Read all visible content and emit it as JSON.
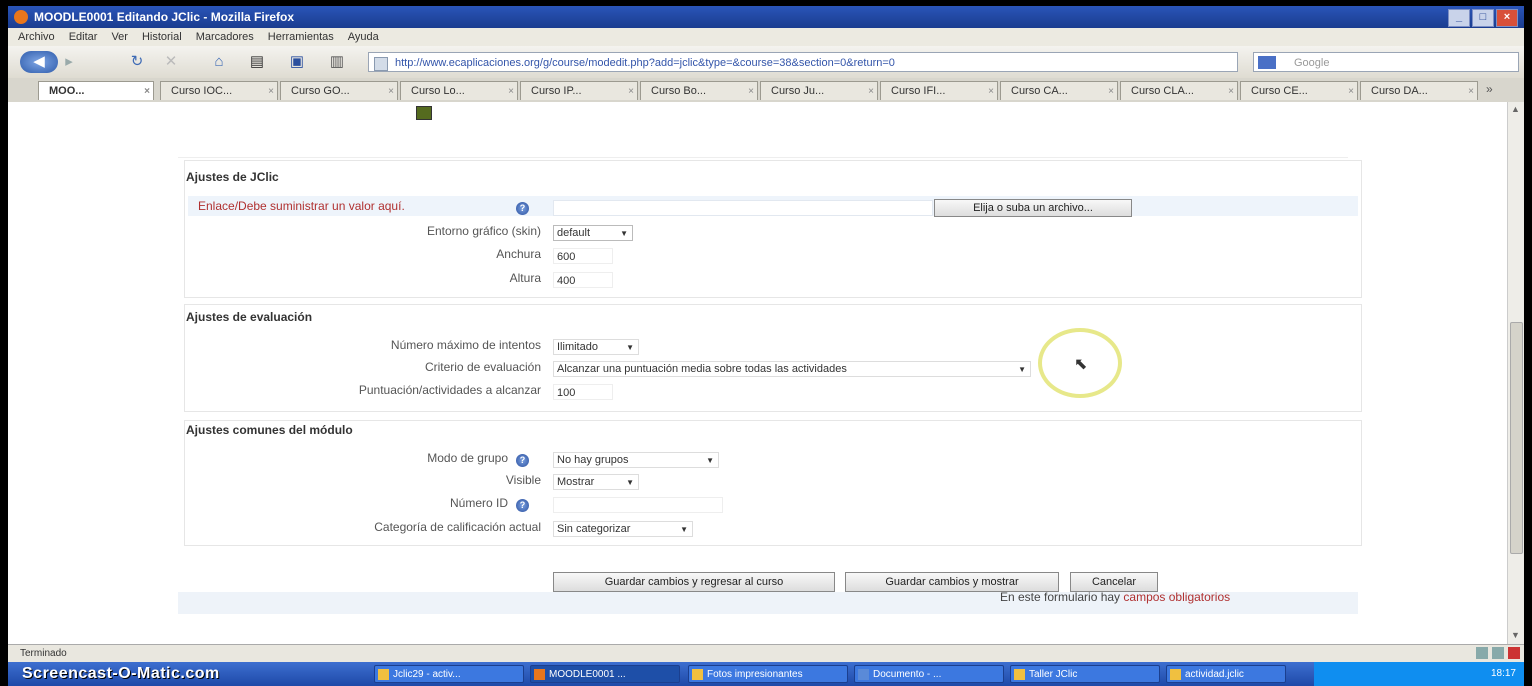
{
  "window": {
    "title": "MOODLE0001 Editando JClic - Mozilla Firefox"
  },
  "menu": [
    "Archivo",
    "Editar",
    "Ver",
    "Historial",
    "Marcadores",
    "Herramientas",
    "Ayuda"
  ],
  "nav": {
    "url": "http://www.ecaplicaciones.org/g/course/modedit.php?add=jclic&type=&course=38&section=0&return=0",
    "search_placeholder": "Google"
  },
  "tabs": [
    {
      "label": "MOO...",
      "active": true
    },
    {
      "label": "Curso IOC..."
    },
    {
      "label": "Curso GO..."
    },
    {
      "label": "Curso Lo..."
    },
    {
      "label": "Curso IP..."
    },
    {
      "label": "Curso Bo..."
    },
    {
      "label": "Curso Ju..."
    },
    {
      "label": "Curso IFI..."
    },
    {
      "label": "Curso CA..."
    },
    {
      "label": "Curso CLA..."
    },
    {
      "label": "Curso CE..."
    },
    {
      "label": "Curso DA..."
    }
  ],
  "jclic": {
    "legend": "Ajustes de JClic",
    "url_label": "Enlace/Debe suministrar un valor aquí.",
    "choose_button": "Elija o suba un archivo...",
    "skin_label": "Entorno gráfico (skin)",
    "skin_value": "default",
    "width_label": "Anchura",
    "width_value": "600",
    "height_label": "Altura",
    "height_value": "400"
  },
  "evaluation": {
    "legend": "Ajustes de evaluación",
    "attempts_label": "Número máximo de intentos",
    "attempts_value": "Ilimitado",
    "criteria_label": "Criterio de evaluación",
    "criteria_value": "Alcanzar una puntuación media sobre todas las actividades",
    "score_label": "Puntuación/actividades a alcanzar",
    "score_value": "100"
  },
  "common": {
    "legend": "Ajustes comunes del módulo",
    "group_label": "Modo de grupo",
    "group_value": "No hay grupos",
    "visible_label": "Visible",
    "visible_value": "Mostrar",
    "id_label": "Número ID",
    "id_value": "",
    "grade_label": "Categoría de calificación actual",
    "grade_value": "Sin categorizar"
  },
  "actions": {
    "save_return": "Guardar cambios y regresar al curso",
    "save_show": "Guardar cambios y mostrar",
    "cancel": "Cancelar"
  },
  "required_note_prefix": "En este formulario hay",
  "required_note_link": "campos obligatorios",
  "status": {
    "text": "Terminado"
  },
  "taskbar": {
    "watermark": "Screencast-O-Matic.com",
    "items": [
      "Jclic29 - activ...",
      "MOODLE0001 ...",
      "Fotos impresionantes",
      "Documento - ...",
      "Taller JClic",
      "actividad.jclic"
    ],
    "clock": "18:17"
  },
  "colors": {
    "required": "#b03030",
    "title_bar": "#1a3c8f",
    "highlight_ring": "#e7e88a"
  }
}
